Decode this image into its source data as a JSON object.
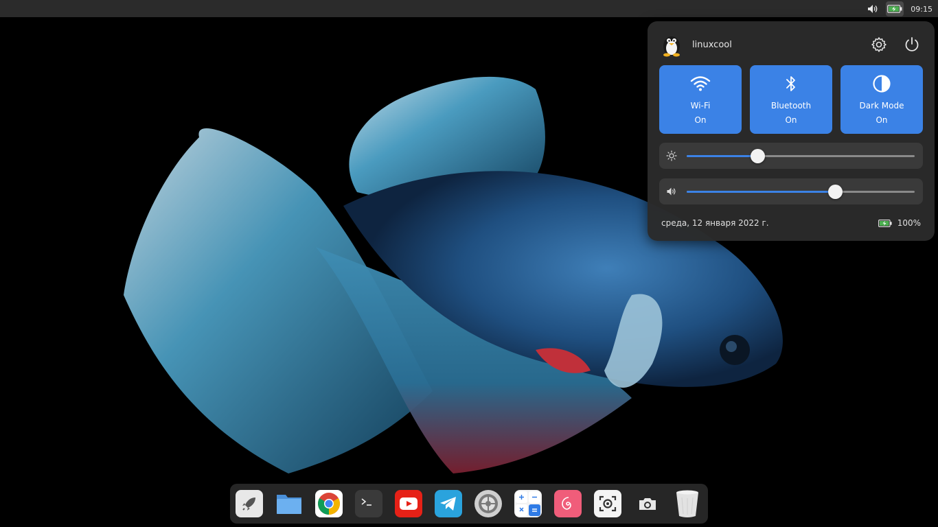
{
  "topbar": {
    "clock": "09:15",
    "icons": [
      "volume-icon",
      "battery-charging-icon"
    ]
  },
  "control_center": {
    "user": {
      "name": "linuxcool",
      "avatar": "tux-avatar"
    },
    "header_buttons": [
      "settings-icon",
      "power-icon"
    ],
    "tiles": [
      {
        "id": "wifi",
        "label": "Wi-Fi",
        "state": "On",
        "icon": "wifi-icon"
      },
      {
        "id": "bluetooth",
        "label": "Bluetooth",
        "state": "On",
        "icon": "bluetooth-icon"
      },
      {
        "id": "dark-mode",
        "label": "Dark Mode",
        "state": "On",
        "icon": "contrast-icon"
      }
    ],
    "brightness": {
      "icon": "brightness-icon",
      "value": 0.31
    },
    "volume": {
      "icon": "volume-icon",
      "value": 0.65
    },
    "date": "среда, 12 января 2022 г.",
    "battery": "100%"
  },
  "dock": {
    "apps": [
      "launcher",
      "files",
      "chrome",
      "terminal",
      "youtube",
      "telegram",
      "settings",
      "calculator",
      "debian",
      "screenshot",
      "camera",
      "trash"
    ]
  },
  "colors": {
    "accent": "#3b82e6",
    "panel": "#2a2a2a",
    "topbar": "#2b2b2b"
  }
}
